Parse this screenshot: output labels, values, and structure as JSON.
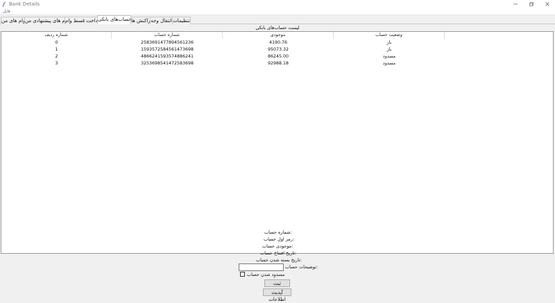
{
  "window": {
    "title": "Bank Details",
    "controls": [
      "minimize-icon",
      "restore-icon",
      "close-icon"
    ]
  },
  "menubar": {
    "items": [
      {
        "label": "فایل"
      }
    ]
  },
  "tabs": [
    {
      "label": "تنظیمات",
      "active": false
    },
    {
      "label": "انتقال وجه",
      "active": false
    },
    {
      "label": "تراکنش ها",
      "active": false
    },
    {
      "label": "حساب‌های بانکی",
      "active": true
    },
    {
      "label": "پرداخت قسط وام",
      "active": false
    },
    {
      "label": "وام های پیشنهادی من",
      "active": false
    },
    {
      "label": "وام های من",
      "active": false
    }
  ],
  "list": {
    "title": "لیست حساب‌های بانکی",
    "columns": [
      "وضعیت حساب",
      "موجودی",
      "شماره حساب",
      "شماره ردیف"
    ],
    "rows": [
      {
        "status": "باز",
        "balance": "4190.76",
        "account": "2583691477894561236",
        "index": "0"
      },
      {
        "status": "باز",
        "balance": "95073.32",
        "account": "1593572584561473698",
        "index": "1"
      },
      {
        "status": "مسدود",
        "balance": "86245.00",
        "account": "4866241593574886241",
        "index": "2"
      },
      {
        "status": "مسدود",
        "balance": "92988.18",
        "account": "3253698541472583698",
        "index": "3"
      }
    ]
  },
  "form": {
    "account_number_label": "شماره حساب:",
    "first_password_label": "رمز اول حساب:",
    "balance_label": "موجودی حساب:",
    "open_date_label": "تاریخ افتتاح حساب:",
    "close_date_label": "تاریخ بسته شدن حساب:",
    "description_label": "توضیحات حساب:",
    "description_value": "",
    "blocked_label": "مسدود شدن حساب",
    "blocked_checked": false,
    "submit_label": "ثبت",
    "update_label": "آپدیت اطلاعات"
  }
}
